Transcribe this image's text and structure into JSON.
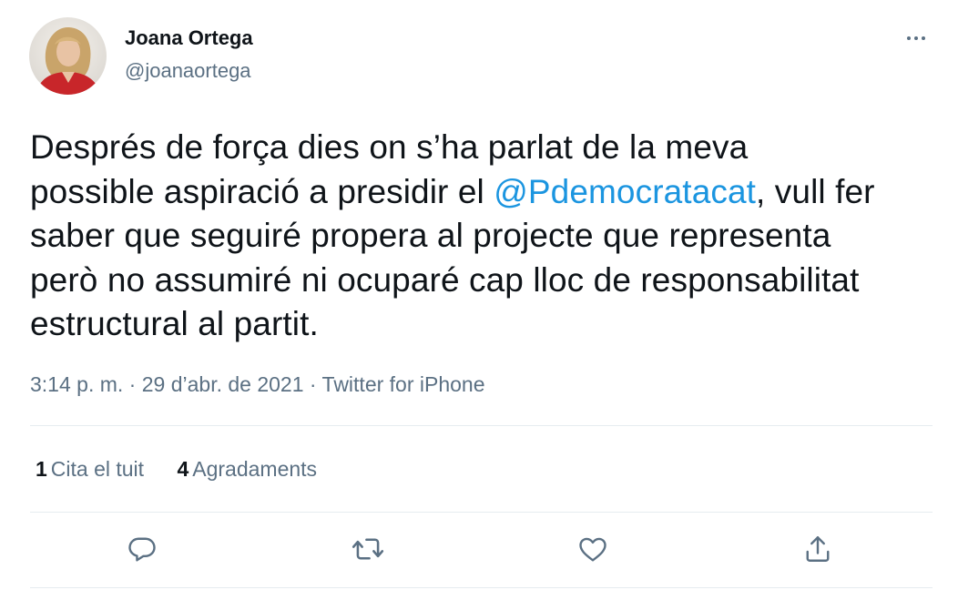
{
  "author": {
    "name": "Joana Ortega",
    "handle": "@joanaortega"
  },
  "tweet": {
    "line1": "Després de força dies on s’ha parlat de la meva",
    "line2_pre": "possible aspiració a presidir el ",
    "mention": "@Pdemocratacat",
    "line2_post": ", vull fer",
    "line3": "saber que seguiré propera al projecte que representa",
    "line4": "però no assumiré ni ocuparé cap lloc de responsabilitat",
    "line5": "estructural al partit."
  },
  "meta": {
    "time": "3:14 p. m.",
    "sep1": " · ",
    "date": "29 d’abr. de 2021",
    "sep2": " · ",
    "source": "Twitter for iPhone"
  },
  "stats": {
    "quotes_count": "1",
    "quotes_label": "Cita el tuit",
    "likes_count": "4",
    "likes_label": "Agradaments"
  },
  "icons": {
    "more": "more-icon",
    "reply": "reply-icon",
    "retweet": "retweet-icon",
    "like": "like-icon",
    "share": "share-icon"
  },
  "colors": {
    "text": "#0f1419",
    "secondary": "#5b7083",
    "link": "#1b95e0",
    "divider": "#e6ecf0"
  }
}
